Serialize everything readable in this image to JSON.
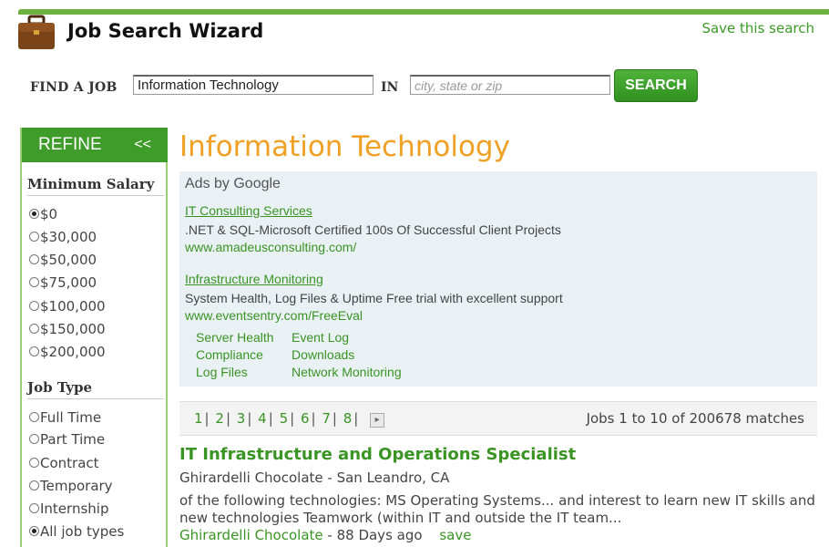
{
  "header": {
    "title": "Job Search Wizard",
    "save_search": "Save this search"
  },
  "search": {
    "find_label": "FIND A JOB",
    "query_value": "Information Technology",
    "in_label": "IN",
    "location_placeholder": "city, state or zip",
    "button_label": "SEARCH"
  },
  "sidebar": {
    "refine_label": "REFINE",
    "collapse_label": "<<",
    "salary_heading": "Minimum Salary",
    "salary_options": [
      "$0",
      "$30,000",
      "$50,000",
      "$75,000",
      "$100,000",
      "$150,000",
      "$200,000"
    ],
    "salary_selected": "$0",
    "jobtype_heading": "Job Type",
    "jobtype_options": [
      "Full Time",
      "Part Time",
      "Contract",
      "Temporary",
      "Internship",
      "All job types"
    ],
    "jobtype_selected": "All job types"
  },
  "main": {
    "title": "Information Technology",
    "ads_label": "Ads by Google",
    "ads": [
      {
        "title": "IT Consulting Services",
        "description": ".NET & SQL-Microsoft Certified 100s Of Successful Client Projects",
        "url": "www.amadeusconsulting.com/"
      },
      {
        "title": "Infrastructure Monitoring",
        "description": "System Health, Log Files & Uptime Free trial with excellent support",
        "url": "www.eventsentry.com/FreeEval"
      }
    ],
    "sublinks": [
      "Server Health",
      "Event Log",
      "Compliance",
      "Downloads",
      "Log Files",
      "Network Monitoring"
    ],
    "pagination": {
      "pages": [
        "1",
        "2",
        "3",
        "4",
        "5",
        "6",
        "7",
        "8"
      ],
      "next_icon": "next-arrow-icon",
      "matches_text": "Jobs 1 to 10 of 200678 matches"
    },
    "job": {
      "title": "IT Infrastructure and Operations Specialist",
      "company_location": "Ghirardelli Chocolate - San Leandro, CA",
      "snippet": "of the following technologies: MS Operating Systems... and interest to learn new IT skills and new technologies Teamwork (within IT and outside the IT team...",
      "company": "Ghirardelli Chocolate",
      "age": " - 88 Days ago",
      "save_label": "save"
    }
  },
  "colors": {
    "brand_green": "#3f9c2a",
    "title_orange": "#f0a024",
    "link_green": "#3a9424",
    "ads_bg": "#e9f1f4"
  }
}
